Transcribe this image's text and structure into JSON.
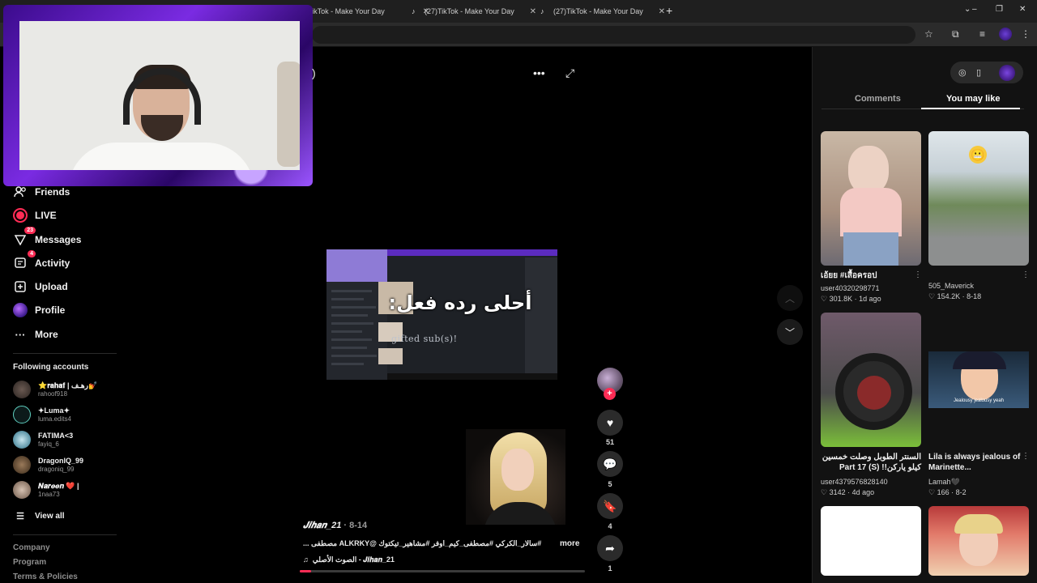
{
  "browser": {
    "tabs": [
      {
        "label": "TikTok - Make Your Day"
      },
      {
        "label": "(27)TikTok - Make Your Day"
      },
      {
        "label": "(27)TikTok - Make Your Day"
      }
    ],
    "new_tab": "+"
  },
  "sidebar": {
    "items": [
      {
        "label": "Friends",
        "icon": "friends-icon"
      },
      {
        "label": "LIVE",
        "icon": "live-icon"
      },
      {
        "label": "Messages",
        "icon": "messages-icon",
        "badge": "23"
      },
      {
        "label": "Activity",
        "icon": "activity-icon",
        "badge": "4"
      },
      {
        "label": "Upload",
        "icon": "upload-icon"
      },
      {
        "label": "Profile",
        "icon": "profile-icon"
      },
      {
        "label": "More",
        "icon": "more-icon"
      }
    ],
    "following_title": "Following accounts",
    "following": [
      {
        "name": "⭐𝐫𝐚𝐡𝐚𝐟 | رهـف💅",
        "user": "rahoof918"
      },
      {
        "name": "✦Luma✦",
        "user": "luma.edits4"
      },
      {
        "name": "FATIMA<3",
        "user": "fayiq_6"
      },
      {
        "name": "DragonIQ_99",
        "user": "dragoniq_99"
      },
      {
        "name": "𝑵𝒂𝒓𝒆𝒆𝒏 ❤️ |",
        "user": "1naa73"
      }
    ],
    "view_all": "View all",
    "footer": [
      "Company",
      "Program",
      "Terms & Policies"
    ]
  },
  "video": {
    "caption": "أحلى رده فعل:",
    "gifted": "gifted sub(s)!",
    "author": "𝑱𝒊𝒉𝒂𝒏_21",
    "date": "8-14",
    "description": "#سالار_الكركي #مصطفى_كيم_اوفر #مشاهير_تيكتوك @ALKRKY مصطفى ...",
    "more": "more",
    "music": "الصوت الأصلي - 𝑱𝒊𝒉𝒂𝒏_21",
    "progress": 0.04,
    "actions": {
      "likes": "51",
      "comments": "5",
      "saves": "4",
      "shares": "1"
    }
  },
  "right_panel": {
    "tabs": [
      "Comments",
      "You may like"
    ],
    "active_tab": "You may like",
    "cards": [
      {
        "title": "เอ้ยย #เสื้อครอป",
        "user": "user40320298771",
        "likes": "301.8K",
        "date": "1d ago"
      },
      {
        "title": "",
        "user": "505_Maverick",
        "likes": "154.2K",
        "date": "8-18"
      },
      {
        "title": "السنتر الطوبل وصلت خمسين كيلو ياركن!! Part 17 (S)",
        "user": "user4379576828140",
        "likes": "3142",
        "date": "4d ago"
      },
      {
        "title": "Lila is always jealous of Marinette...",
        "user": "Lamah🖤",
        "likes": "166",
        "date": "8-2"
      },
      {
        "title": "",
        "user": "",
        "likes": "",
        "date": ""
      },
      {
        "title": "",
        "user": "",
        "likes": "",
        "date": ""
      }
    ],
    "sticker_text": "Jealousy jealousy yeah"
  },
  "colors": {
    "accent": "#fe2c55",
    "panel": "#121212",
    "webcam_frame": "#7a2be2"
  }
}
